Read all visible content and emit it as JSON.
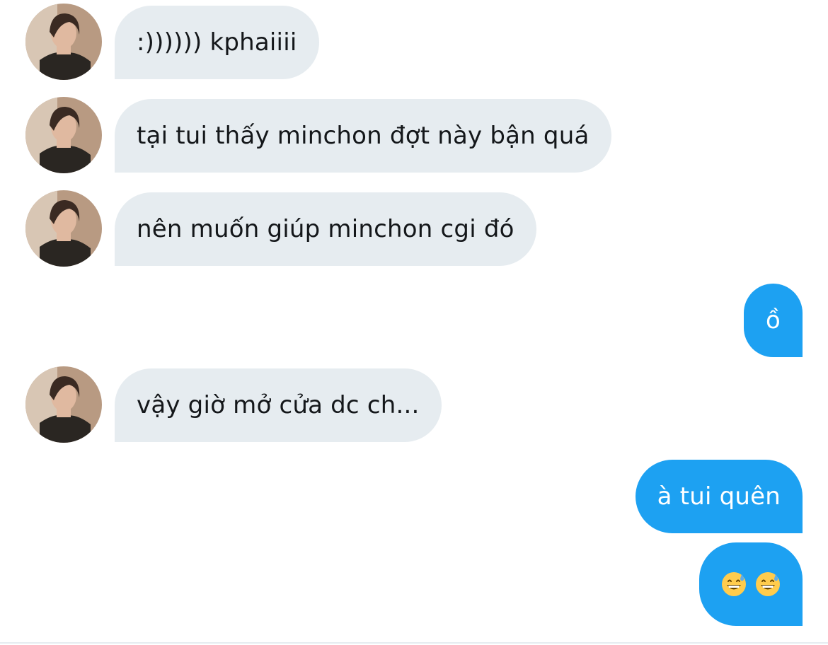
{
  "conversation": {
    "messages": [
      {
        "direction": "incoming",
        "text": ":)))))) kphaiiii"
      },
      {
        "direction": "incoming",
        "text": "tại tui thấy minchon đợt này bận quá"
      },
      {
        "direction": "incoming",
        "text": "nên muốn giúp minchon cgi đó"
      },
      {
        "direction": "outgoing",
        "text": "ồ"
      },
      {
        "direction": "incoming",
        "text": "vậy giờ mở cửa dc ch..."
      },
      {
        "direction": "outgoing",
        "text": "à tui quên"
      },
      {
        "direction": "outgoing",
        "text": "😅😅",
        "emoji_icons": [
          "grinning-sweat-emoji",
          "grinning-sweat-emoji"
        ]
      }
    ]
  },
  "colors": {
    "incoming_bubble": "#e6ecf0",
    "incoming_text": "#14171a",
    "outgoing_bubble": "#1da1f2",
    "outgoing_text": "#ffffff"
  }
}
